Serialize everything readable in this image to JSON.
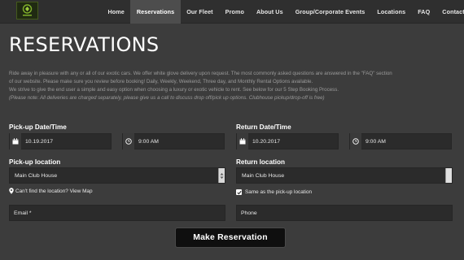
{
  "nav": {
    "items": [
      {
        "label": "Home",
        "active": false
      },
      {
        "label": "Reservations",
        "active": true
      },
      {
        "label": "Our Fleet",
        "active": false
      },
      {
        "label": "Promo",
        "active": false
      },
      {
        "label": "About Us",
        "active": false
      },
      {
        "label": "Group/Corporate Events",
        "active": false
      },
      {
        "label": "Locations",
        "active": false
      },
      {
        "label": "FAQ",
        "active": false
      },
      {
        "label": "Contact Us",
        "active": false
      }
    ]
  },
  "page": {
    "title": "RESERVATIONS",
    "intro": [
      "Ride away in pleasure with any or all of our exotic cars. We offer white glove delivery upon request. The most commonly asked questions are answered in the \"FAQ\" section",
      "of our website. Please make sure you review before booking! Daily, Weekly, Weekend, Three day, and Monthly Rental Options available.",
      "We strive to give the end user a simple and easy option when choosing a luxury or exotic vehicle to rent. See below for our 5 Step Booking Process."
    ],
    "note": "(Please note: All deliveries are charged separately, please give us a call to discuss drop off/pick up options. Clubhouse pickup/drop-off is free)"
  },
  "form": {
    "pickup_datetime_label": "Pick-up Date/Time",
    "pickup_date": "10.19.2017",
    "pickup_time": "9:00 AM",
    "return_datetime_label": "Return Date/Time",
    "return_date": "10.20.2017",
    "return_time": "9:00 AM",
    "pickup_location_label": "Pick-up location",
    "pickup_location": "Main Club House",
    "cant_find_link": "Can't find the location? View Map",
    "return_location_label": "Return location",
    "return_location": "Main Club House",
    "same_as_pickup": "Same as the pick-up location",
    "same_as_pickup_checked": true,
    "email_placeholder": "Email *",
    "phone_placeholder": "Phone",
    "submit_label": "Make Reservation"
  }
}
